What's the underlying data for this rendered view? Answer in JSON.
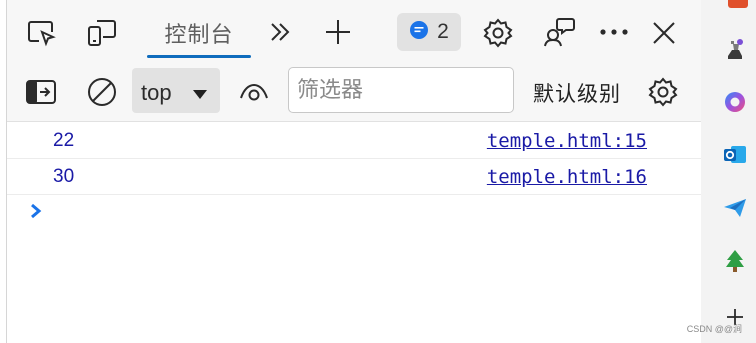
{
  "tabbar": {
    "tabs": [
      {
        "label": "控制台"
      }
    ],
    "issues_count": "2"
  },
  "filterbar": {
    "context": "top",
    "filter_placeholder": "筛选器",
    "levels_label": "默认级别"
  },
  "console": {
    "rows": [
      {
        "value": "22",
        "source": "temple.html:15"
      },
      {
        "value": "30",
        "source": "temple.html:16"
      }
    ]
  },
  "watermark": "CSDN @@涧",
  "colors": {
    "accent": "#0f6cbd",
    "log_text": "#1a1aa6",
    "prompt": "#1a73e8"
  },
  "icons": [
    "inspect-icon",
    "device-emulation-icon",
    "more-tabs-icon",
    "add-tab-icon",
    "issues-icon",
    "settings-icon",
    "feedback-icon",
    "more-options-icon",
    "close-icon",
    "sidebar-toggle-icon",
    "clear-console-icon",
    "context-dropdown-icon",
    "live-expression-icon",
    "console-settings-icon",
    "prompt-icon",
    "chess-icon",
    "copilot-icon",
    "outlook-icon",
    "send-icon",
    "tree-icon",
    "add-icon"
  ]
}
